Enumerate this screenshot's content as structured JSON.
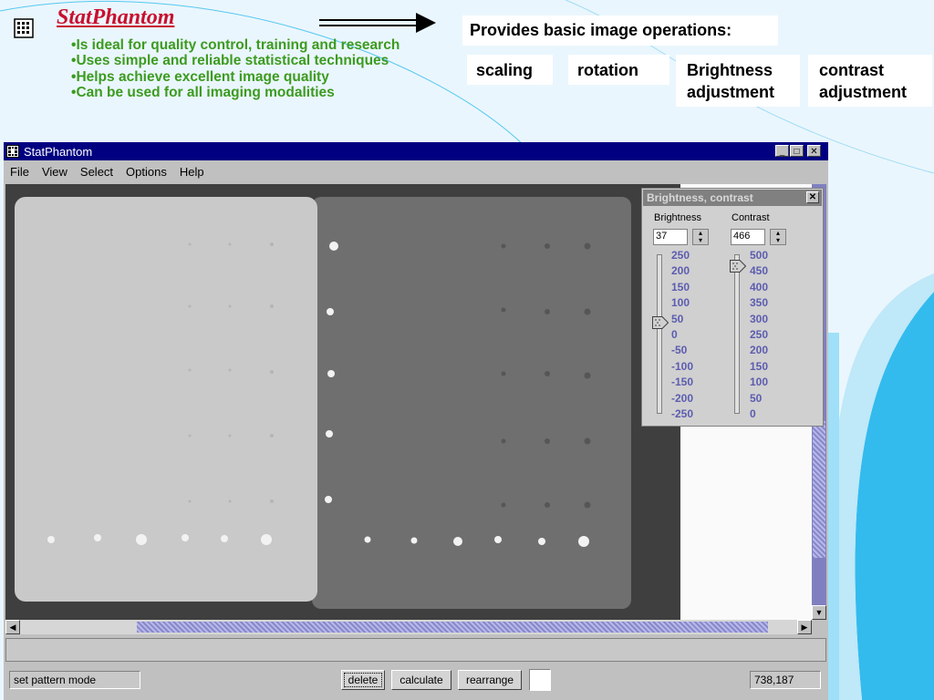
{
  "header": {
    "title": "StatPhantom",
    "bullets": [
      "Is ideal for quality control, training and research",
      "Uses simple and reliable statistical techniques",
      "Helps achieve excellent image quality",
      "Can be used for all imaging modalities"
    ]
  },
  "callouts": {
    "provides": "Provides basic image operations:",
    "scaling": "scaling",
    "rotation": "rotation",
    "brightness_line1": "Brightness",
    "brightness_line2": "adjustment",
    "contrast_line1": "contrast",
    "contrast_line2": "adjustment"
  },
  "window": {
    "title": "StatPhantom",
    "menu": [
      "File",
      "View",
      "Select",
      "Options",
      "Help"
    ]
  },
  "dialog": {
    "title": "Brightness, contrast",
    "brightness_label": "Brightness",
    "contrast_label": "Contrast",
    "brightness_value": "37",
    "contrast_value": "466",
    "brightness_ticks": [
      "250",
      "200",
      "150",
      "100",
      "50",
      "0",
      "-50",
      "-100",
      "-150",
      "-200",
      "-250"
    ],
    "contrast_ticks": [
      "500",
      "450",
      "400",
      "350",
      "300",
      "250",
      "200",
      "150",
      "100",
      "50",
      "0"
    ],
    "brightness_level": 37,
    "contrast_level": 466
  },
  "bottombar": {
    "mode": "set pattern mode",
    "delete_label": "delete",
    "calculate_label": "calculate",
    "rearrange_label": "rearrange",
    "coords": "738,187"
  },
  "colors": {
    "title": "#c8102e",
    "bullets": "#3c9b1f",
    "titlebar": "#000080",
    "accent_cyan": "#33bbee"
  },
  "icons": {
    "app": "grid-icon",
    "arrow": "double-arrow-right-icon"
  }
}
